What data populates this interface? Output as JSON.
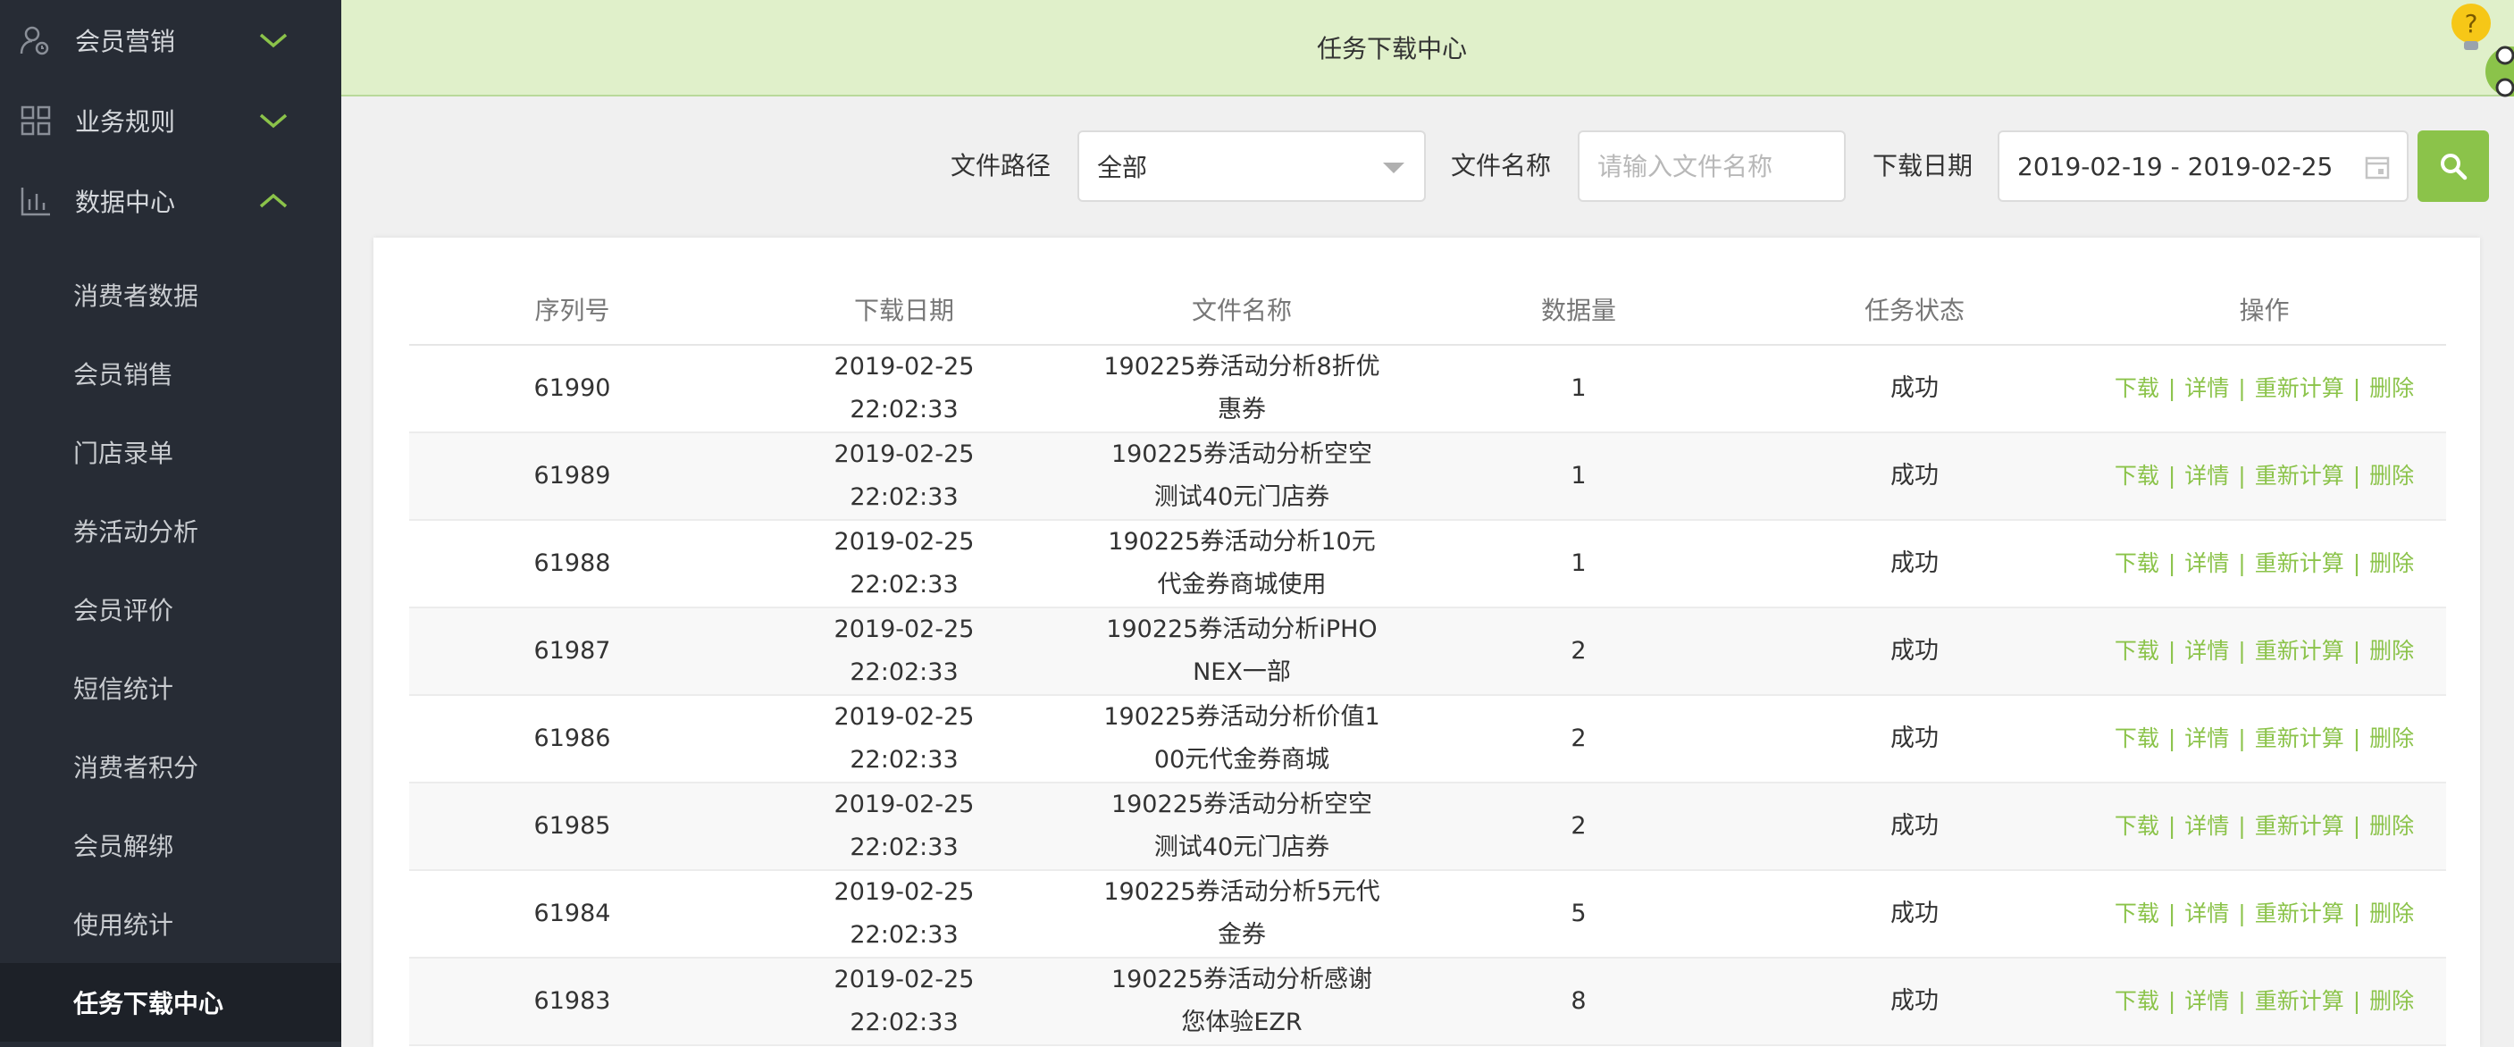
{
  "sidebar": {
    "groups": [
      {
        "label": "会员营销",
        "icon": "member-marketing-icon",
        "expanded": false
      },
      {
        "label": "业务规则",
        "icon": "grid-icon",
        "expanded": false
      },
      {
        "label": "数据中心",
        "icon": "bar-chart-icon",
        "expanded": true
      }
    ],
    "items": [
      {
        "label": "消费者数据"
      },
      {
        "label": "会员销售"
      },
      {
        "label": "门店录单"
      },
      {
        "label": "券活动分析"
      },
      {
        "label": "会员评价"
      },
      {
        "label": "短信统计"
      },
      {
        "label": "消费者积分"
      },
      {
        "label": "会员解绑"
      },
      {
        "label": "使用统计"
      },
      {
        "label": "任务下载中心",
        "active": true
      }
    ]
  },
  "header": {
    "title": "任务下载中心"
  },
  "filter": {
    "path_label": "文件路径",
    "path_value": "全部",
    "name_label": "文件名称",
    "name_placeholder": "请输入文件名称",
    "date_label": "下载日期",
    "date_value": "2019-02-19 - 2019-02-25"
  },
  "table": {
    "columns": [
      "序列号",
      "下载日期",
      "文件名称",
      "数据量",
      "任务状态",
      "操作"
    ],
    "ops": {
      "download": "下载",
      "detail": "详情",
      "recalc": "重新计算",
      "delete": "删除",
      "sep": "|"
    },
    "rows": [
      {
        "id": "61990",
        "date": "2019-02-25 22:02:33",
        "name": "190225券活动分析8折优惠券",
        "count": "1",
        "status": "成功"
      },
      {
        "id": "61989",
        "date": "2019-02-25 22:02:33",
        "name": "190225券活动分析空空测试40元门店券",
        "count": "1",
        "status": "成功"
      },
      {
        "id": "61988",
        "date": "2019-02-25 22:02:33",
        "name": "190225券活动分析10元代金券商城使用",
        "count": "1",
        "status": "成功"
      },
      {
        "id": "61987",
        "date": "2019-02-25 22:02:33",
        "name": "190225券活动分析iPHONEX一部",
        "count": "2",
        "status": "成功"
      },
      {
        "id": "61986",
        "date": "2019-02-25 22:02:33",
        "name": "190225券活动分析价值100元代金券商城",
        "count": "2",
        "status": "成功"
      },
      {
        "id": "61985",
        "date": "2019-02-25 22:02:33",
        "name": "190225券活动分析空空测试40元门店券",
        "count": "2",
        "status": "成功"
      },
      {
        "id": "61984",
        "date": "2019-02-25 22:02:33",
        "name": "190225券活动分析5元代金券",
        "count": "5",
        "status": "成功"
      },
      {
        "id": "61983",
        "date": "2019-02-25 22:02:33",
        "name": "190225券活动分析感谢您体验EZR",
        "count": "8",
        "status": "成功"
      }
    ]
  },
  "colors": {
    "accent": "#8bc34a",
    "sidebar_bg": "#272c35",
    "header_bg": "#e0f0ca"
  }
}
